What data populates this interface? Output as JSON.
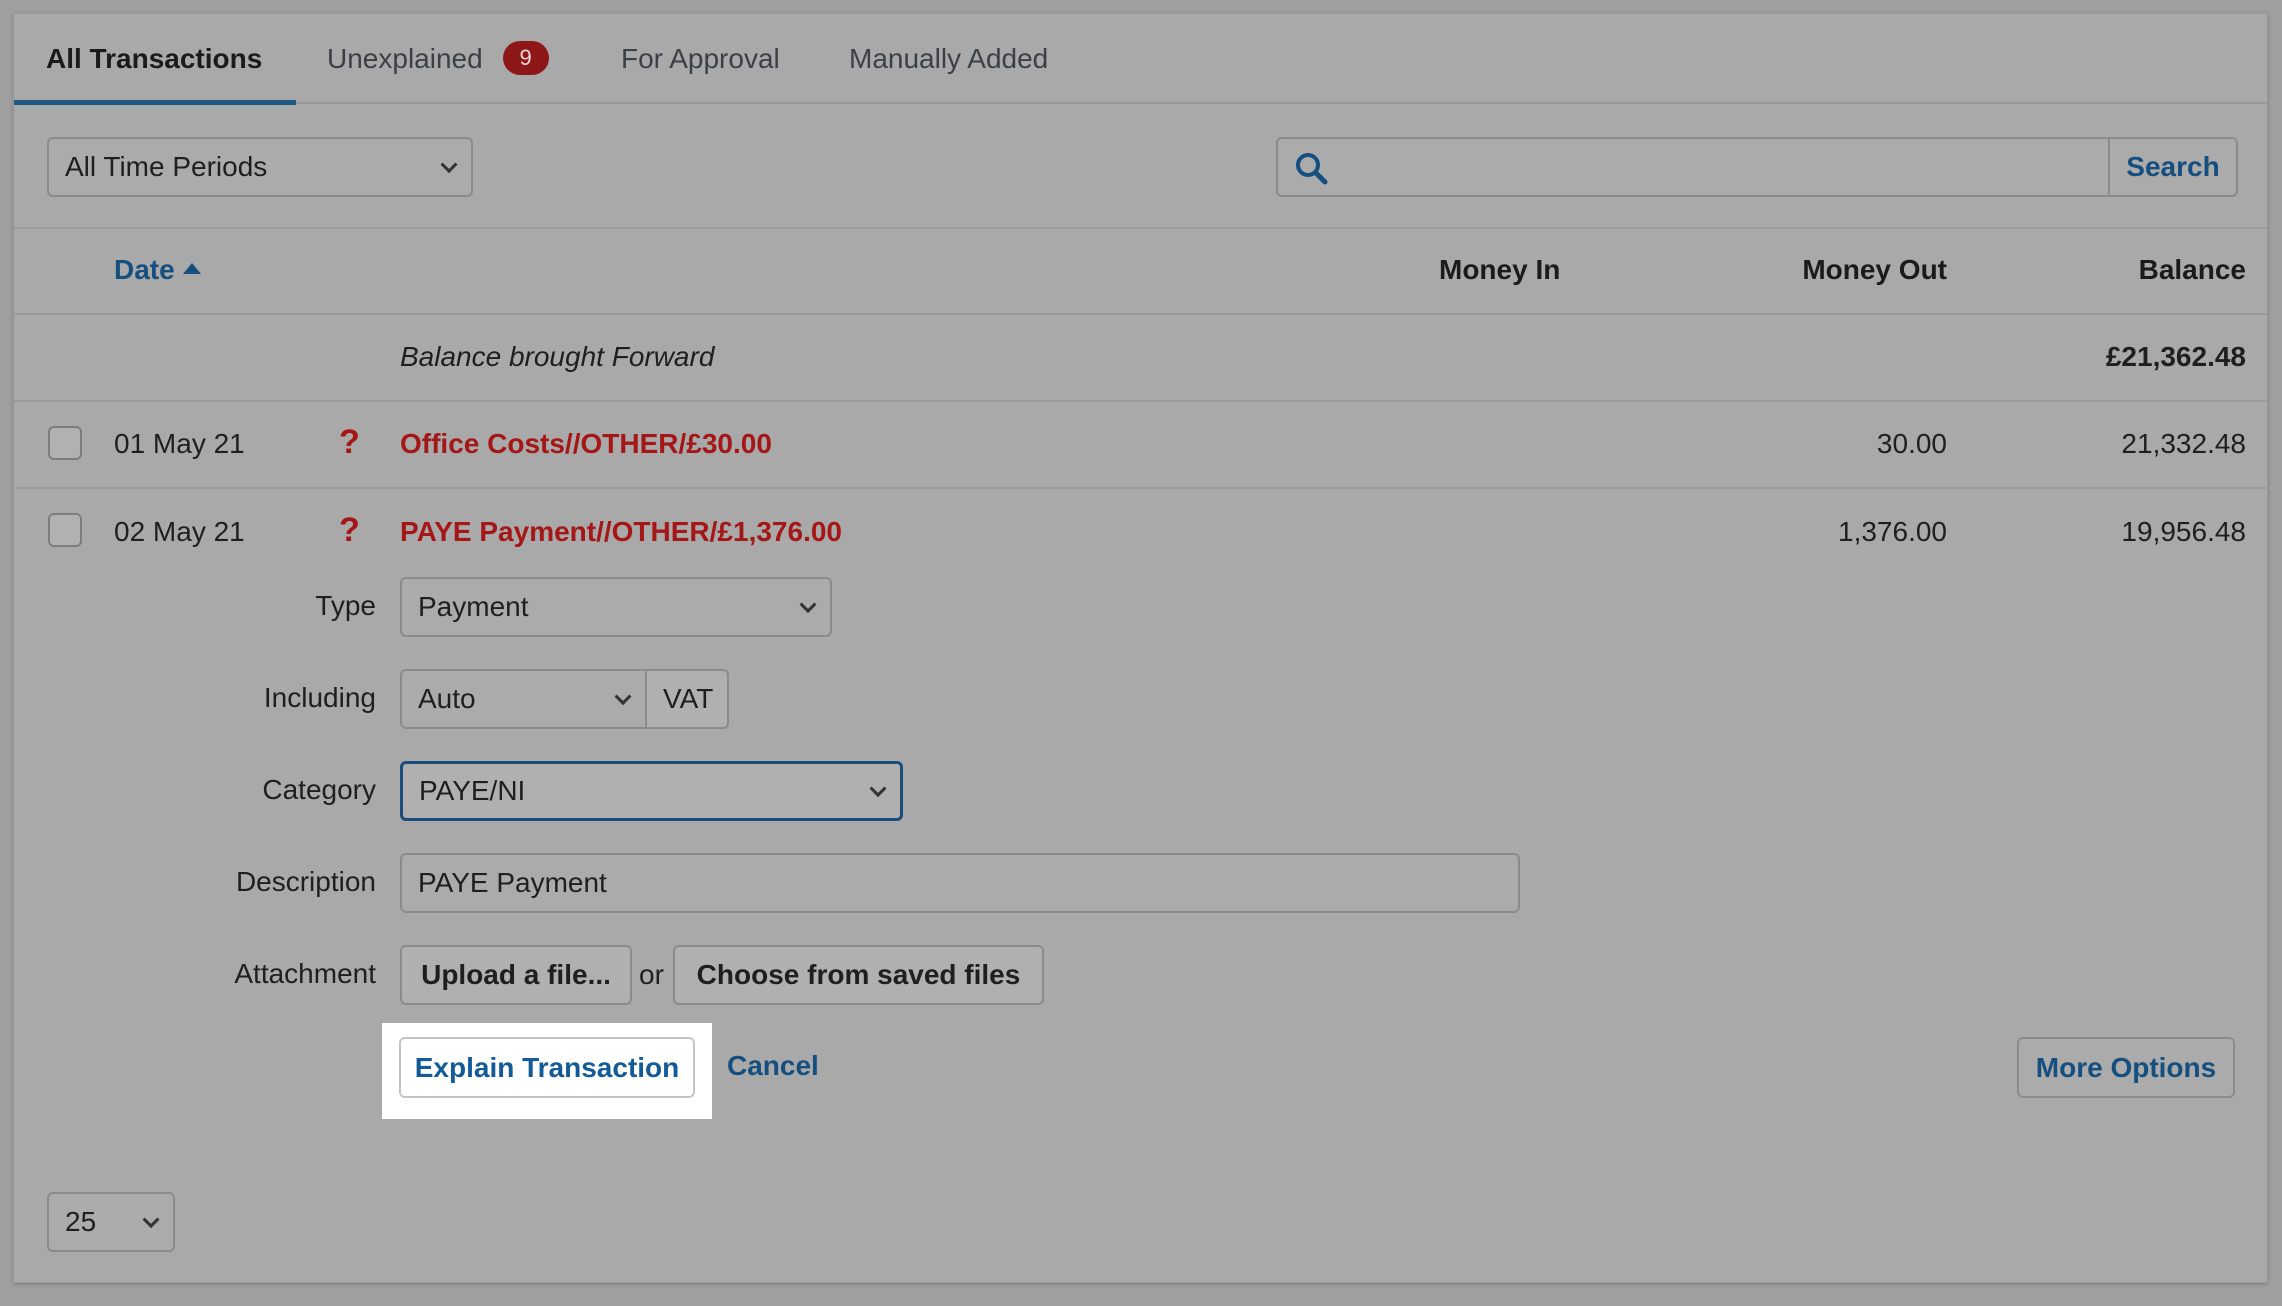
{
  "tabs": [
    {
      "label": "All Transactions",
      "active": true
    },
    {
      "label": "Unexplained",
      "badge": "9"
    },
    {
      "label": "For Approval"
    },
    {
      "label": "Manually Added"
    }
  ],
  "filters": {
    "period": "All Time Periods",
    "search_button": "Search",
    "search_value": ""
  },
  "table": {
    "headers": {
      "date": "Date",
      "money_in": "Money In",
      "money_out": "Money Out",
      "balance": "Balance"
    },
    "brought_forward": {
      "label": "Balance brought Forward",
      "balance": "£21,362.48"
    },
    "rows": [
      {
        "date": "01 May 21",
        "description": "Office Costs//OTHER/£30.00",
        "money_out": "30.00",
        "balance": "21,332.48"
      },
      {
        "date": "02 May 21",
        "description": "PAYE Payment//OTHER/£1,376.00",
        "money_out": "1,376.00",
        "balance": "19,956.48"
      }
    ]
  },
  "form": {
    "type_label": "Type",
    "type_value": "Payment",
    "including_label": "Including",
    "including_value": "Auto",
    "vat_label": "VAT",
    "category_label": "Category",
    "category_value": "PAYE/NI",
    "description_label": "Description",
    "description_value": "PAYE Payment",
    "attachment_label": "Attachment",
    "upload_button": "Upload a file...",
    "or_text": "or",
    "choose_button": "Choose from saved files",
    "explain_button": "Explain Transaction",
    "cancel_link": "Cancel",
    "more_options_button": "More Options"
  },
  "pagination": {
    "per_page": "25"
  },
  "colors": {
    "accent": "#154f80",
    "error": "#a51616",
    "badge": "#8e1717"
  }
}
